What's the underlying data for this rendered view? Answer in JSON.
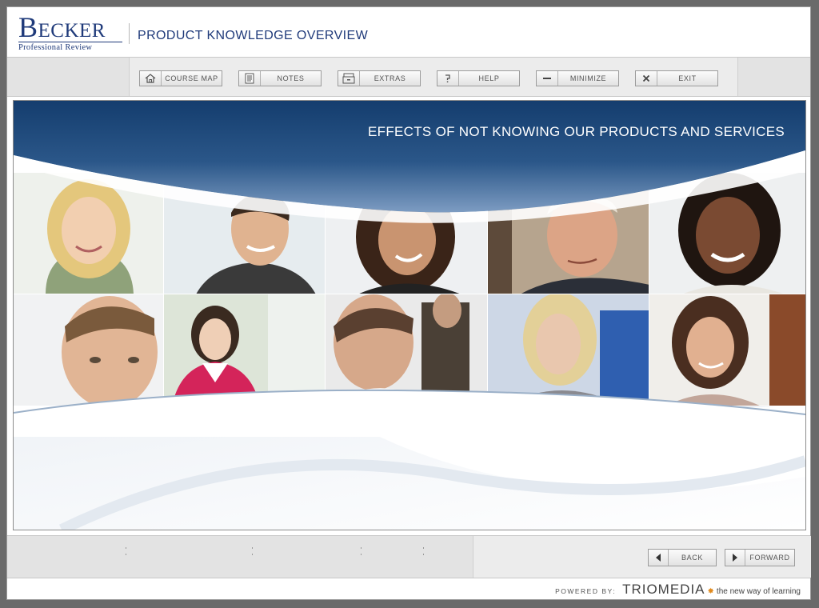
{
  "header": {
    "logo_main": "Becker",
    "logo_sub": "Professional Review",
    "course_title": "PRODUCT KNOWLEDGE OVERVIEW"
  },
  "toolbar": {
    "course_map": "COURSE MAP",
    "notes": "NOTES",
    "extras": "EXTRAS",
    "help": "HELP",
    "minimize": "MINIMIZE",
    "exit": "EXIT"
  },
  "slide": {
    "title": "EFFECTS OF NOT KNOWING OUR PRODUCTS AND SERVICES"
  },
  "nav": {
    "back": "BACK",
    "forward": "FORWARD"
  },
  "footer": {
    "powered_by": "POWERED BY:",
    "brand": "TRIOMEDIA",
    "tagline": "the new way of learning"
  },
  "colors": {
    "brand_blue": "#1f3a7a",
    "banner_dark": "#143d6e",
    "banner_light": "#6e90b8",
    "accent_orange": "#e08a1e"
  }
}
